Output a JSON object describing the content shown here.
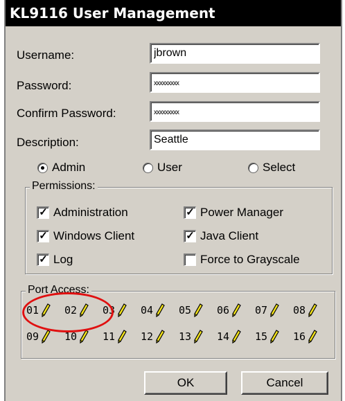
{
  "window": {
    "title": "KL9116 User Management"
  },
  "form": {
    "username_label": "Username:",
    "username_value": "jbrown",
    "password_label": "Password:",
    "password_value": "xxxxxxxxx",
    "confirm_label": "Confirm Password:",
    "confirm_value": "xxxxxxxxx",
    "description_label": "Description:",
    "description_value": "Seattle"
  },
  "role": {
    "options": [
      {
        "label": "Admin",
        "selected": true
      },
      {
        "label": "User",
        "selected": false
      },
      {
        "label": "Select",
        "selected": false
      }
    ]
  },
  "permissions": {
    "title": "Permissions:",
    "items": [
      {
        "label": "Administration",
        "checked": true
      },
      {
        "label": "Windows Client",
        "checked": true
      },
      {
        "label": "Log",
        "checked": true
      },
      {
        "label": "Power Manager",
        "checked": true
      },
      {
        "label": "Java Client",
        "checked": true
      },
      {
        "label": "Force to Grayscale",
        "checked": false
      }
    ]
  },
  "port_access": {
    "title": "Port Access:",
    "ports": [
      "01",
      "02",
      "03",
      "04",
      "05",
      "06",
      "07",
      "08",
      "09",
      "10",
      "11",
      "12",
      "13",
      "14",
      "15",
      "16"
    ],
    "icon": "pencil-icon"
  },
  "buttons": {
    "ok": "OK",
    "cancel": "Cancel"
  },
  "colors": {
    "title_bg": "#000000",
    "dialog_bg": "#d4d0c8",
    "highlight": "#e01010",
    "pencil": "#f2e21a"
  }
}
